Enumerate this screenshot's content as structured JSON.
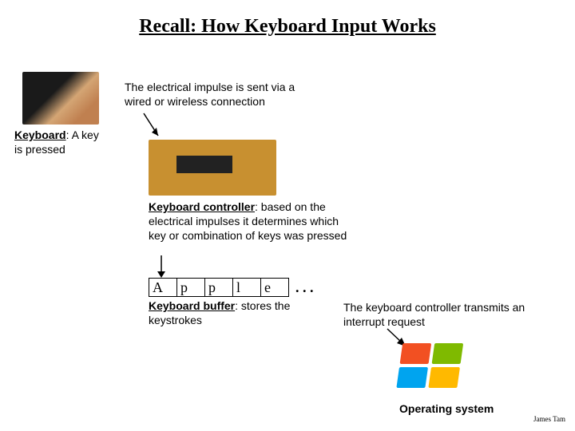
{
  "title": "Recall: How Keyboard Input Works",
  "keyboard": {
    "label": "Keyboard",
    "desc": ": A key is pressed"
  },
  "impulse": "The electrical impulse is sent via a wired or wireless connection",
  "controller": {
    "label": "Keyboard controller",
    "desc": ": based on the electrical impulses it determines which key or combination of keys was pressed"
  },
  "buffer": {
    "cells": [
      "A",
      "p",
      "p",
      "l",
      "e"
    ],
    "dots": ". . .",
    "label": "Keyboard buffer",
    "desc": ": stores the keystrokes"
  },
  "interrupt": "The keyboard controller transmits an interrupt request",
  "os": "Operating system",
  "author": "James Tam"
}
